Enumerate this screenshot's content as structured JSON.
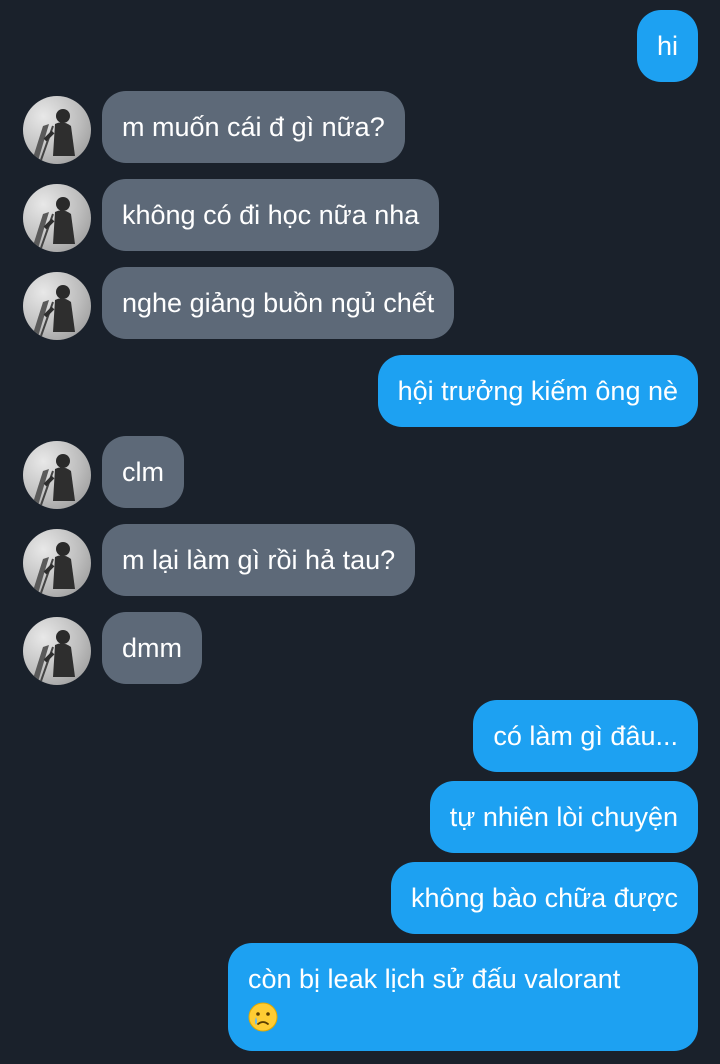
{
  "messages": [
    {
      "from": "me",
      "text": "hi"
    },
    {
      "from": "them",
      "text": "m muốn cái đ gì nữa?"
    },
    {
      "from": "them",
      "text": "không có đi học nữa nha"
    },
    {
      "from": "them",
      "text": "nghe giảng buồn ngủ chết"
    },
    {
      "from": "me",
      "text": "hội trưởng kiếm ông nè"
    },
    {
      "from": "them",
      "text": "clm"
    },
    {
      "from": "them",
      "text": "m lại làm gì rồi hả tau?"
    },
    {
      "from": "them",
      "text": "dmm"
    },
    {
      "from": "me",
      "text": "có làm gì đâu..."
    },
    {
      "from": "me",
      "text": "tự nhiên lòi chuyện"
    },
    {
      "from": "me",
      "text": "không bào chữa được"
    },
    {
      "from": "me",
      "text": "còn bị leak lịch sử đấu valorant",
      "emoji": "crying-face"
    }
  ],
  "colors": {
    "background": "#1a212b",
    "incoming_bubble": "#5d6978",
    "outgoing_bubble": "#1da1f2",
    "text": "#ffffff"
  }
}
